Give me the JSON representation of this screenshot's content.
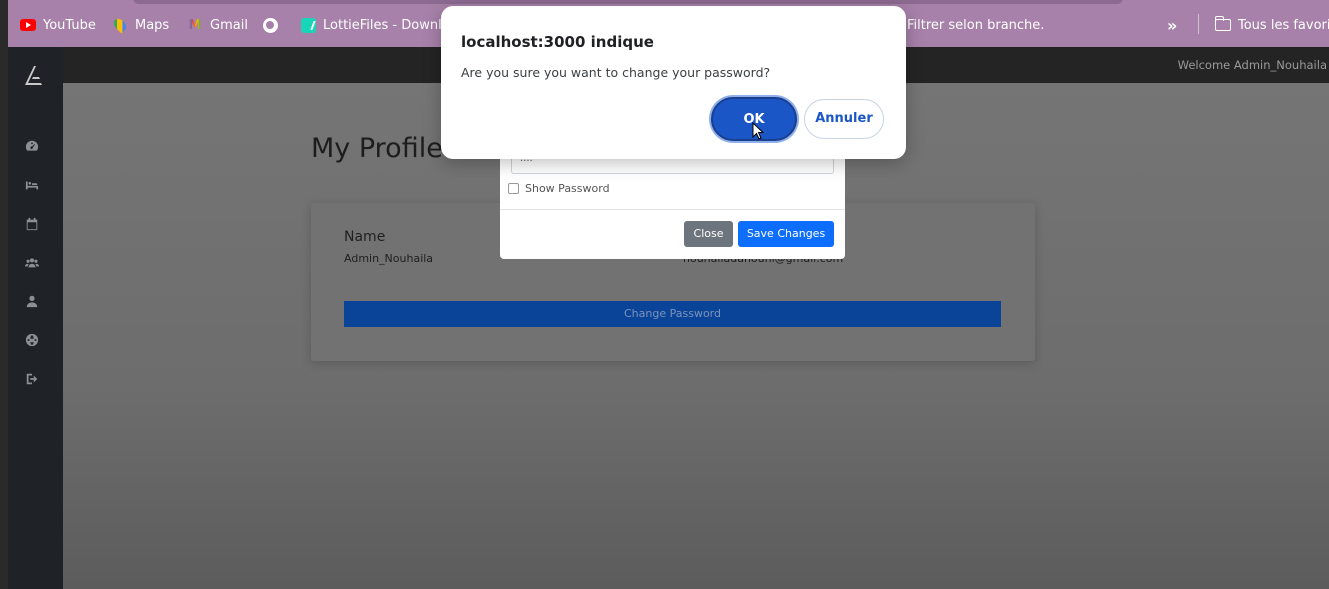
{
  "browser": {
    "bookmarks": [
      {
        "label": "YouTube",
        "icon": "youtube-icon"
      },
      {
        "label": "Maps",
        "icon": "maps-icon"
      },
      {
        "label": "Gmail",
        "icon": "gmail-icon"
      },
      {
        "label": "",
        "icon": "globe-icon"
      },
      {
        "label": "LottieFiles - Downlo...",
        "icon": "lottiefiles-icon"
      },
      {
        "label": "Filtrer selon branche.",
        "icon": ""
      }
    ],
    "more_icon": "chevrons-right-icon",
    "all_bookmarks_label": "Tous les favoris",
    "bar_color": "#a781a9"
  },
  "app": {
    "welcome_text": "Welcome Admin_Nouhaila",
    "sidebar_icons": [
      "dashboard-icon",
      "bed-icon",
      "calendar-icon",
      "users-icon",
      "user-icon",
      "globe-icon",
      "logout-icon"
    ],
    "page_title": "My Profile",
    "profile": {
      "name_label": "Name",
      "name_value": "Admin_Nouhaila",
      "email_value": "nouhailadahouni@gmail.com",
      "change_password_label": "Change Password"
    },
    "modal": {
      "password_value": "....",
      "show_password_label": "Show Password",
      "close_label": "Close",
      "save_label": "Save Changes"
    }
  },
  "dialog": {
    "title": "localhost:3000 indique",
    "message": "Are you sure you want to change your password?",
    "ok_label": "OK",
    "cancel_label": "Annuler",
    "accent": "#1a56c6"
  }
}
